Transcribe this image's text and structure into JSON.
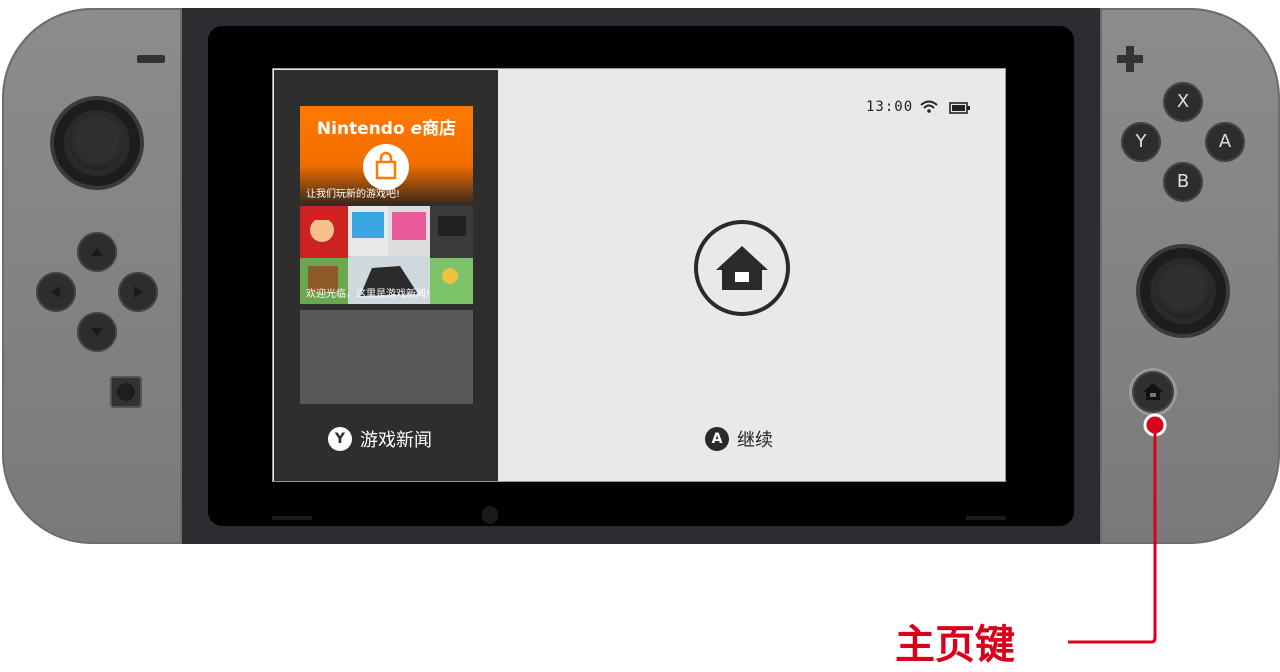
{
  "screen": {
    "status": {
      "time": "13:00",
      "wifi_icon": "wifi-icon",
      "battery_icon": "battery-icon"
    },
    "left_panel": {
      "shop_tile": {
        "title": "Nintendo eShop商店",
        "title_display": "Nintendo",
        "title_suffix": "商店",
        "caption": "让我们玩新的游戏吧!"
      },
      "news_tile": {
        "caption": "欢迎光临，这里是游戏新闻!"
      },
      "footer": {
        "button_glyph": "Y",
        "label": "游戏新闻"
      }
    },
    "main_panel": {
      "icon": "home-icon",
      "footer": {
        "button_glyph": "A",
        "label": "继续"
      }
    }
  },
  "controller": {
    "right_buttons": [
      "X",
      "Y",
      "A",
      "B"
    ]
  },
  "callout": {
    "label": "主页键",
    "color": "#d8001a"
  }
}
